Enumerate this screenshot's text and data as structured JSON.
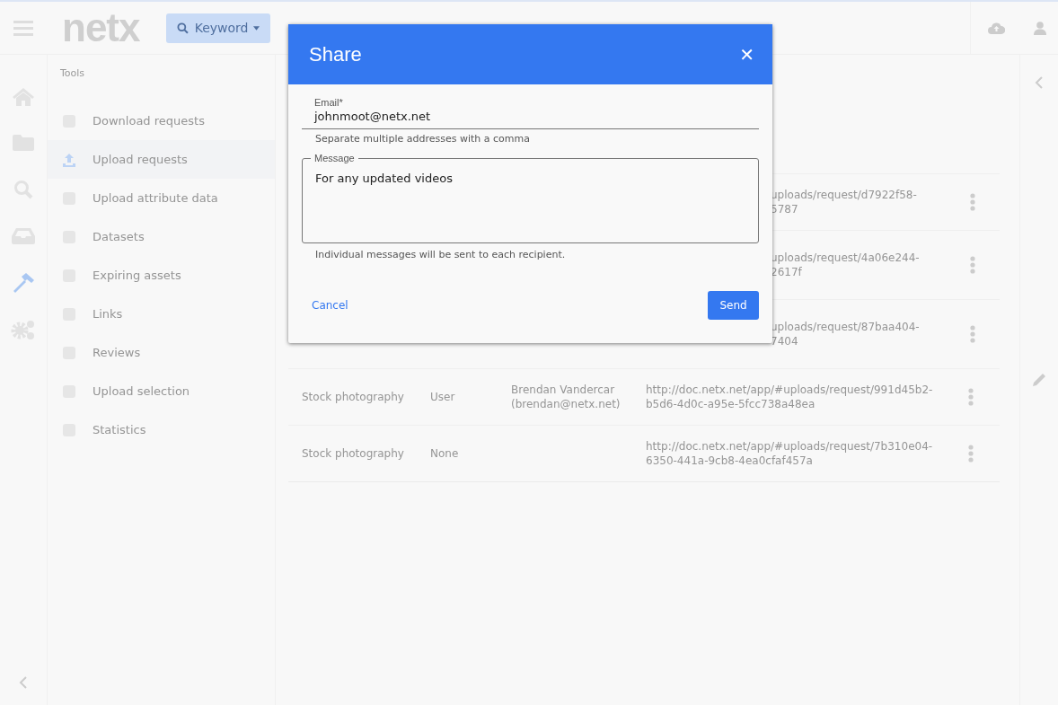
{
  "topbar": {
    "logo": "netx",
    "search_button": "Keyword"
  },
  "rail": [
    {
      "selected": false
    },
    {
      "selected": false
    },
    {
      "selected": false
    },
    {
      "selected": false
    },
    {
      "selected": true
    },
    {
      "selected": false
    }
  ],
  "tools": {
    "title": "Tools",
    "items": [
      {
        "label": "Download requests",
        "selected": false
      },
      {
        "label": "Upload requests",
        "selected": true
      },
      {
        "label": "Upload attribute data",
        "selected": false
      },
      {
        "label": "Datasets",
        "selected": false
      },
      {
        "label": "Expiring assets",
        "selected": false
      },
      {
        "label": "Links",
        "selected": false
      },
      {
        "label": "Reviews",
        "selected": false
      },
      {
        "label": "Upload selection",
        "selected": false
      },
      {
        "label": "Statistics",
        "selected": false
      }
    ]
  },
  "table": {
    "rows": [
      {
        "covered": true,
        "link": [
          "uploads/request/d7922f58-",
          "5787"
        ]
      },
      {
        "covered": true,
        "link": [
          "uploads/request/4a06e244-",
          "2617f"
        ]
      },
      {
        "covered": true,
        "link": [
          "uploads/request/87baa404-",
          "7404"
        ]
      },
      {
        "covered": false,
        "name": "Stock photography",
        "access": "User",
        "user": [
          "Brendan Vandercar",
          "(brendan@netx.net)"
        ],
        "link": [
          "http://doc.netx.net/app/#uploads/request/991d45b2-",
          "b5d6-4d0c-a95e-5fcc738a48ea"
        ]
      },
      {
        "covered": false,
        "name": "Stock photography",
        "access": "None",
        "link": [
          "http://doc.netx.net/app/#uploads/request/7b310e04-",
          "6350-441a-9cb8-4ea0cfaf457a"
        ]
      }
    ]
  },
  "dialog": {
    "title": "Share",
    "close": "✕",
    "email": {
      "label": "Email*",
      "value": "johnmoot@netx.net",
      "hint": "Separate multiple addresses with a comma"
    },
    "message": {
      "label": "Message",
      "value": "For any updated videos",
      "hint": "Individual messages will be sent to each recipient."
    },
    "cancel": "Cancel",
    "send": "Send"
  }
}
